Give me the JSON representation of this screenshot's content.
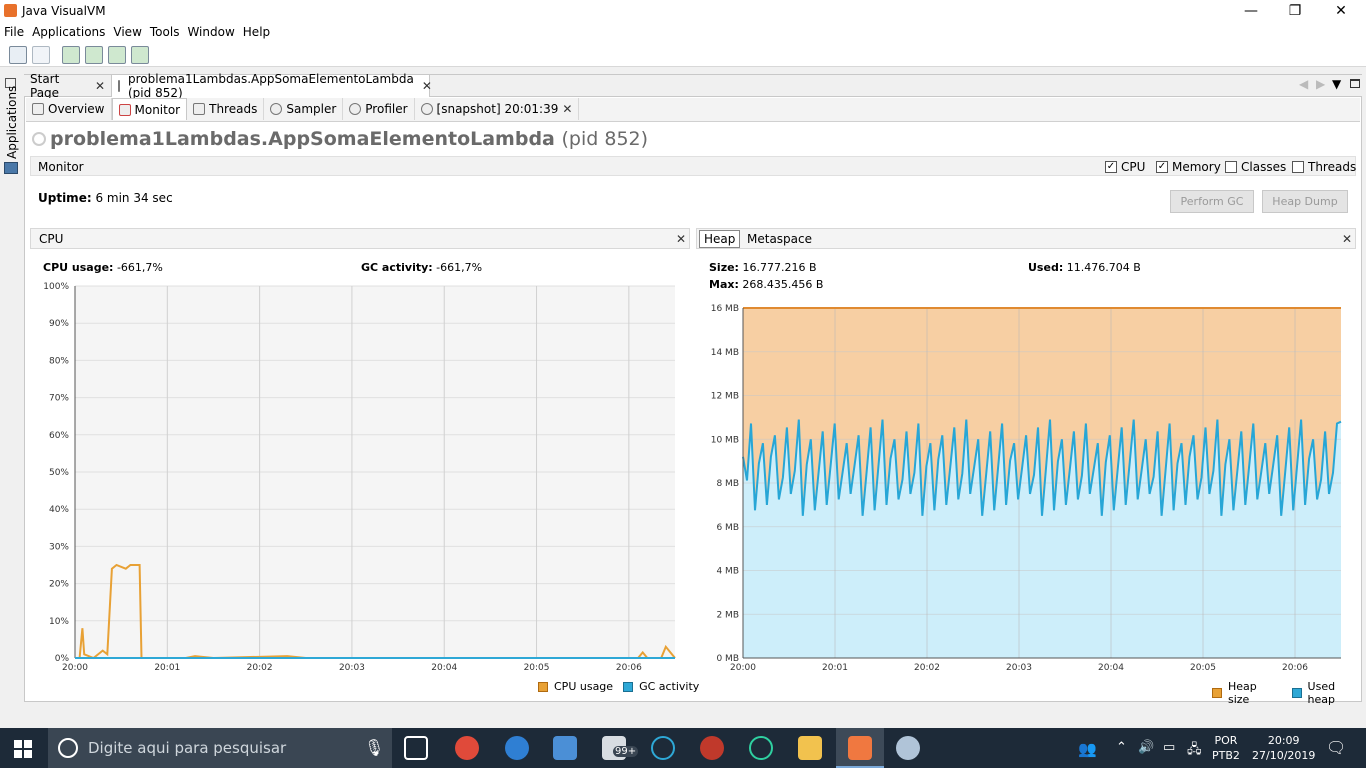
{
  "window": {
    "title": "Java VisualVM"
  },
  "menu": [
    "File",
    "Applications",
    "View",
    "Tools",
    "Window",
    "Help"
  ],
  "left_rail": {
    "label": "Applications"
  },
  "doc_tabs": [
    {
      "label": "Start Page",
      "active": false
    },
    {
      "label": "problema1Lambdas.AppSomaElementoLambda (pid 852)",
      "active": true
    }
  ],
  "sub_tabs": [
    {
      "label": "Overview",
      "icon": "overview-icon"
    },
    {
      "label": "Monitor",
      "icon": "monitor-icon",
      "active": true
    },
    {
      "label": "Threads",
      "icon": "threads-icon"
    },
    {
      "label": "Sampler",
      "icon": "sampler-icon"
    },
    {
      "label": "Profiler",
      "icon": "profiler-icon"
    },
    {
      "label": "[snapshot] 20:01:39",
      "icon": "snapshot-icon"
    }
  ],
  "app": {
    "name": "problema1Lambdas.AppSomaElementoLambda",
    "pid": "(pid 852)"
  },
  "monitor": {
    "label": "Monitor",
    "checkboxes": [
      {
        "label": "CPU",
        "checked": true
      },
      {
        "label": "Memory",
        "checked": true
      },
      {
        "label": "Classes",
        "checked": false
      },
      {
        "label": "Threads",
        "checked": false
      }
    ],
    "uptime_label": "Uptime:",
    "uptime_value": "6 min 34 sec",
    "perform_gc": "Perform GC",
    "heap_dump": "Heap Dump"
  },
  "cpu_panel": {
    "title": "CPU",
    "cpu_usage_label": "CPU usage:",
    "cpu_usage_value": "-661,7%",
    "gc_label": "GC activity:",
    "gc_value": "-661,7%",
    "legend": [
      "CPU usage",
      "GC activity"
    ]
  },
  "heap_panel": {
    "tabs": [
      "Heap",
      "Metaspace"
    ],
    "size_label": "Size:",
    "size_value": "16.777.216 B",
    "used_label": "Used:",
    "used_value": "11.476.704 B",
    "max_label": "Max:",
    "max_value": "268.435.456 B",
    "legend": [
      "Heap size",
      "Used heap"
    ]
  },
  "colors": {
    "cpu": "#e8a135",
    "gc": "#2ea8d6",
    "heap_fill": "#f7cfa3",
    "used_fill": "#cdeefa",
    "heap_line": "#e08a30",
    "used_line": "#27a6d6"
  },
  "chart_data": [
    {
      "type": "line",
      "title": "CPU",
      "x": [
        "20:00",
        "20:01",
        "20:02",
        "20:03",
        "20:04",
        "20:05",
        "20:06"
      ],
      "yticks": [
        "0%",
        "10%",
        "20%",
        "30%",
        "40%",
        "50%",
        "60%",
        "70%",
        "80%",
        "90%",
        "100%"
      ],
      "ylim": [
        0,
        100
      ],
      "series": [
        {
          "name": "CPU usage",
          "points": [
            [
              0,
              0
            ],
            [
              0.05,
              0
            ],
            [
              0.08,
              8
            ],
            [
              0.1,
              1
            ],
            [
              0.2,
              0
            ],
            [
              0.3,
              2
            ],
            [
              0.35,
              1
            ],
            [
              0.4,
              24
            ],
            [
              0.45,
              25
            ],
            [
              0.55,
              24
            ],
            [
              0.6,
              25
            ],
            [
              0.7,
              25
            ],
            [
              0.72,
              0
            ],
            [
              0.8,
              0
            ],
            [
              1.2,
              0
            ],
            [
              1.3,
              0.5
            ],
            [
              1.5,
              0
            ],
            [
              2.3,
              0.5
            ],
            [
              2.5,
              0
            ],
            [
              6.1,
              0
            ],
            [
              6.15,
              1.5
            ],
            [
              6.2,
              0
            ],
            [
              6.35,
              0
            ],
            [
              6.4,
              3
            ],
            [
              6.5,
              0
            ]
          ]
        },
        {
          "name": "GC activity",
          "points": [
            [
              0,
              0
            ],
            [
              6.5,
              0
            ]
          ]
        }
      ],
      "legend": "bottom-right"
    },
    {
      "type": "area",
      "title": "Heap",
      "x": [
        "20:00",
        "20:01",
        "20:02",
        "20:03",
        "20:04",
        "20:05",
        "20:06"
      ],
      "yticks": [
        "0 MB",
        "2 MB",
        "4 MB",
        "6 MB",
        "8 MB",
        "10 MB",
        "12 MB",
        "14 MB",
        "16 MB"
      ],
      "ylim": [
        0,
        16
      ],
      "series": [
        {
          "name": "Heap size",
          "value_mb": 16
        },
        {
          "name": "Used heap",
          "min_mb": 6.5,
          "max_mb": 10.9,
          "start_mb": 9.2,
          "end_mb": 10.8
        }
      ],
      "legend": "bottom-right"
    }
  ]
}
